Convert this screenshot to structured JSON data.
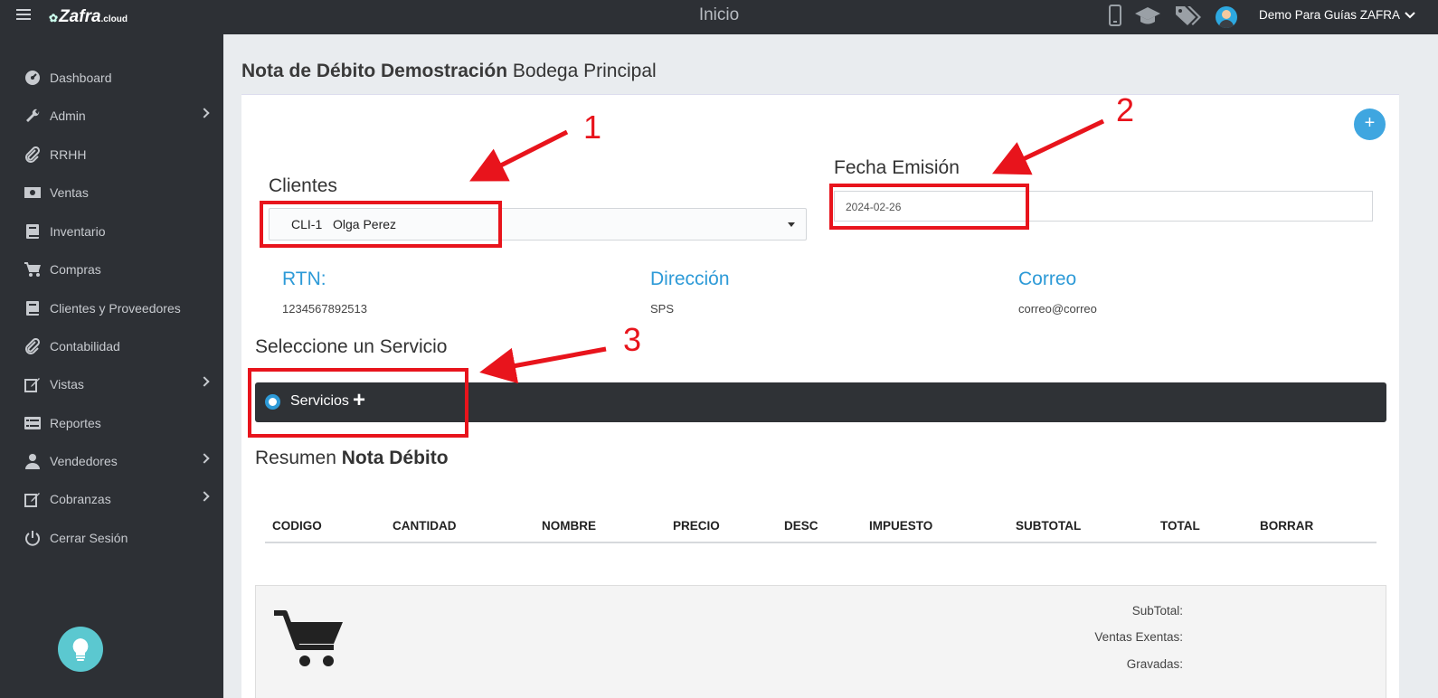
{
  "header": {
    "brand": "Zafra",
    "brand_suffix": ".cloud",
    "title": "Inicio",
    "user_name": "Demo Para Guías ZAFRA",
    "icons": [
      "mobile-icon",
      "graduation-cap-icon",
      "tags-icon",
      "avatar"
    ]
  },
  "sidebar": {
    "items": [
      {
        "label": "Dashboard",
        "icon": "dashboard-icon",
        "has_children": false
      },
      {
        "label": "Admin",
        "icon": "wrench-icon",
        "has_children": true
      },
      {
        "label": "RRHH",
        "icon": "paperclip-icon",
        "has_children": false
      },
      {
        "label": "Ventas",
        "icon": "money-icon",
        "has_children": false
      },
      {
        "label": "Inventario",
        "icon": "book-icon",
        "has_children": false
      },
      {
        "label": "Compras",
        "icon": "cart-icon",
        "has_children": false
      },
      {
        "label": "Clientes y Proveedores",
        "icon": "book-icon",
        "has_children": false
      },
      {
        "label": "Contabilidad",
        "icon": "paperclip-icon",
        "has_children": false
      },
      {
        "label": "Vistas",
        "icon": "edit-icon",
        "has_children": true
      },
      {
        "label": "Reportes",
        "icon": "list-icon",
        "has_children": false
      },
      {
        "label": "Vendedores",
        "icon": "user-icon",
        "has_children": true
      },
      {
        "label": "Cobranzas",
        "icon": "edit-icon",
        "has_children": true
      },
      {
        "label": "Cerrar Sesión",
        "icon": "power-icon",
        "has_children": false
      }
    ]
  },
  "page": {
    "title_bold": "Nota de Débito Demostración",
    "title_rest": "Bodega Principal",
    "add_button": "+"
  },
  "form": {
    "clientes_label": "Clientes",
    "cliente_code": "CLI-1",
    "cliente_name": "Olga Perez",
    "fecha_label": "Fecha Emisión",
    "fecha_value": "2024-02-26"
  },
  "client_info": {
    "rtn_label": "RTN:",
    "rtn_value": "1234567892513",
    "direccion_label": "Dirección",
    "direccion_value": "SPS",
    "correo_label": "Correo",
    "correo_value": "correo@correo"
  },
  "servicio": {
    "section_title": "Seleccione un Servicio",
    "option_label": "Servicios",
    "option_plus": "+"
  },
  "resumen": {
    "title_light": "Resumen",
    "title_bold": "Nota Débito",
    "columns": [
      "CODIGO",
      "CANTIDAD",
      "NOMBRE",
      "PRECIO",
      "DESC",
      "IMPUESTO",
      "SUBTOTAL",
      "TOTAL",
      "BORRAR"
    ]
  },
  "summary": {
    "labels": [
      "SubTotal:",
      "Ventas Exentas:",
      "Gravadas:"
    ]
  },
  "annotations": {
    "numbers": [
      "1",
      "2",
      "3"
    ],
    "color": "#e8141c"
  },
  "colors": {
    "sidebar_bg": "#2d3035",
    "accent_blue": "#2d9ad7",
    "bulb": "#5bc8d0"
  }
}
